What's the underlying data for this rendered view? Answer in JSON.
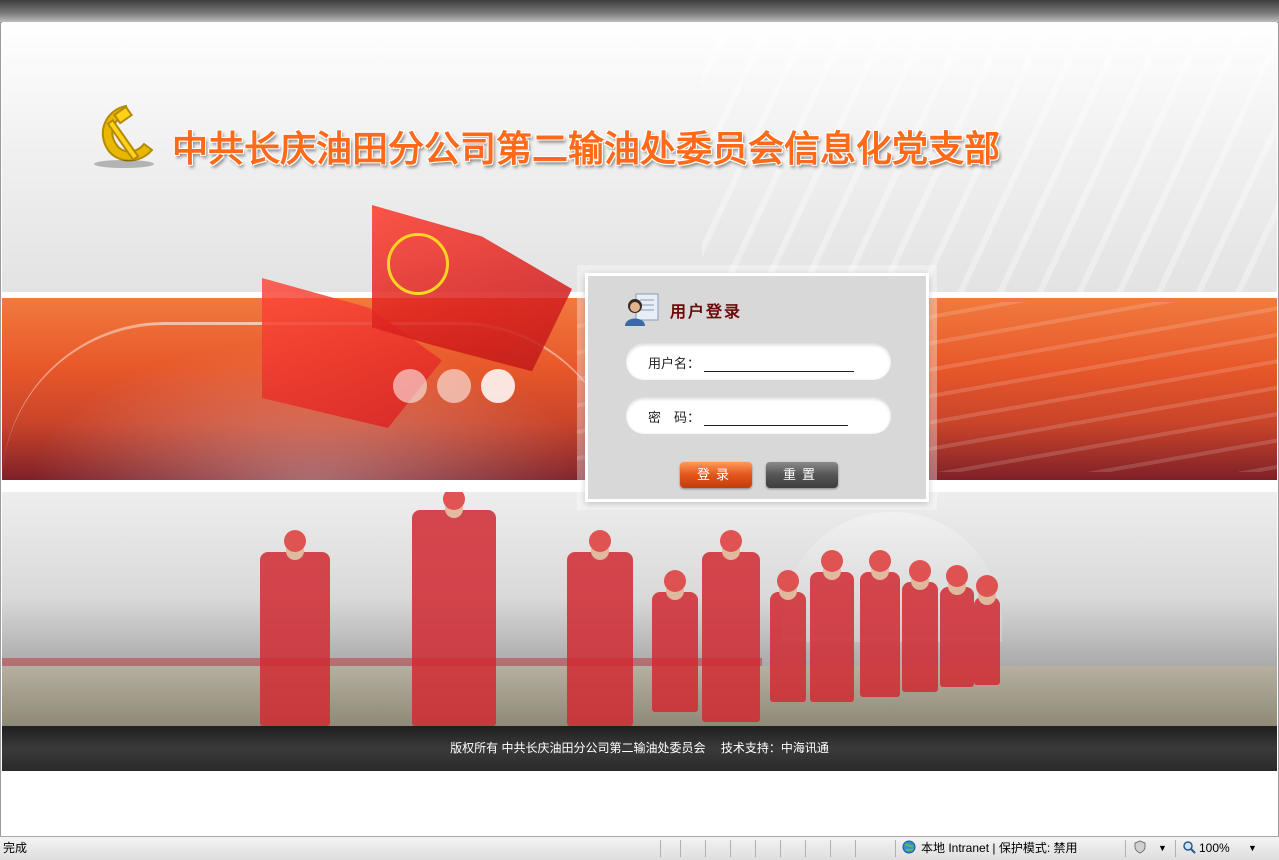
{
  "header": {
    "site_title": "中共长庆油田分公司第二输油处委员会信息化党支部"
  },
  "login": {
    "title": "用户登录",
    "username_label": "用户名：",
    "username_value": "",
    "password_label": "密　码：",
    "password_value": "",
    "login_button": "登录",
    "reset_button": "重置"
  },
  "footer": {
    "copyright": "版权所有 中共长庆油田分公司第二输油处委员会",
    "support": "技术支持：中海讯通"
  },
  "statusbar": {
    "status": "完成",
    "zone": "本地 Intranet | 保护模式: 禁用",
    "zoom": "100%"
  },
  "icons": {
    "party_logo": "hammer-sickle-icon",
    "login_icon": "user-card-icon",
    "zone_icon": "globe-icon",
    "security_icon": "shield-icon",
    "zoom_icon": "magnifier-icon"
  },
  "colors": {
    "title_orange": "#ff6a1a",
    "login_title": "#6b0a0a",
    "login_button": "#e2551c",
    "reset_button": "#555555",
    "footer_bg": "#2a2a2a"
  }
}
